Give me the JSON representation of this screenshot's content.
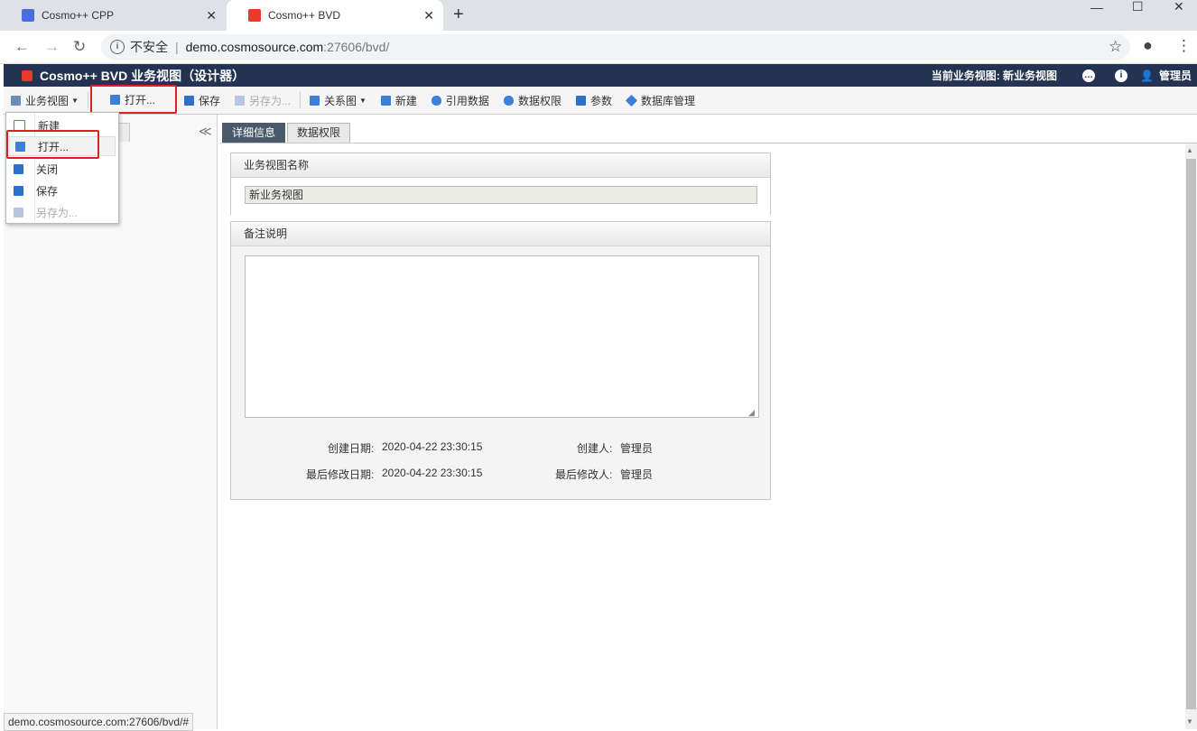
{
  "browser": {
    "tabs": [
      {
        "title": "Cosmo++ CPP",
        "active": false,
        "favicon_color": "#4a6ee0"
      },
      {
        "title": "Cosmo++ BVD",
        "active": true,
        "favicon_color": "#e8392a"
      }
    ],
    "new_tab": "+",
    "window_controls": {
      "minimize": "—",
      "maximize": "☐",
      "close": "✕"
    },
    "nav": {
      "back": "←",
      "forward": "→",
      "reload": "↻"
    },
    "address": {
      "security": "不安全",
      "host": "demo.cosmosource.com",
      "port_path": ":27606/bvd/"
    },
    "star": "☆",
    "account": "●",
    "menu": "⋮",
    "status_url": "demo.cosmosource.com:27606/bvd/#"
  },
  "app": {
    "title": "Cosmo++ BVD 业务视图（设计器）",
    "current_view_label": "当前业务视图: 新业务视图",
    "user": "管理员",
    "colors": {
      "header_bg": "#253352",
      "accent": "#e8392a",
      "highlight": "#e02020"
    }
  },
  "toolbar": {
    "items": [
      {
        "label": "业务视图",
        "icon": "document-icon",
        "dropdown": true
      },
      {
        "label": "打开...",
        "icon": "folder-open-icon",
        "highlighted": true
      },
      {
        "label": "保存",
        "icon": "save-icon"
      },
      {
        "label": "另存为...",
        "icon": "save-as-icon",
        "disabled": true
      },
      {
        "label": "关系图",
        "icon": "diagram-icon",
        "dropdown": true
      },
      {
        "label": "新建",
        "icon": "new-icon"
      },
      {
        "label": "引用数据",
        "icon": "database-icon"
      },
      {
        "label": "数据权限",
        "icon": "database-lock-icon"
      },
      {
        "label": "参数",
        "icon": "params-icon"
      },
      {
        "label": "数据库管理",
        "icon": "cube-icon"
      }
    ]
  },
  "dropdown_menu": {
    "items": [
      {
        "label": "新建",
        "icon": "new-file-icon"
      },
      {
        "label": "打开...",
        "icon": "folder-open-icon",
        "highlighted": true
      },
      {
        "label": "关闭",
        "icon": "folder-close-icon"
      },
      {
        "label": "保存",
        "icon": "save-icon"
      },
      {
        "label": "另存为...",
        "icon": "save-as-icon",
        "disabled": true
      }
    ]
  },
  "left_panel": {
    "collapse": "≪"
  },
  "content": {
    "tabs": [
      {
        "label": "详细信息",
        "active": true
      },
      {
        "label": "数据权限",
        "active": false
      }
    ],
    "name_section": {
      "header": "业务视图名称",
      "value": "新业务视图"
    },
    "remarks_section": {
      "header": "备注说明",
      "value": ""
    },
    "meta": {
      "created_date_label": "创建日期:",
      "created_date": "2020-04-22 23:30:15",
      "creator_label": "创建人:",
      "creator": "管理员",
      "modified_date_label": "最后修改日期:",
      "modified_date": "2020-04-22 23:30:15",
      "modifier_label": "最后修改人:",
      "modifier": "管理员"
    }
  }
}
